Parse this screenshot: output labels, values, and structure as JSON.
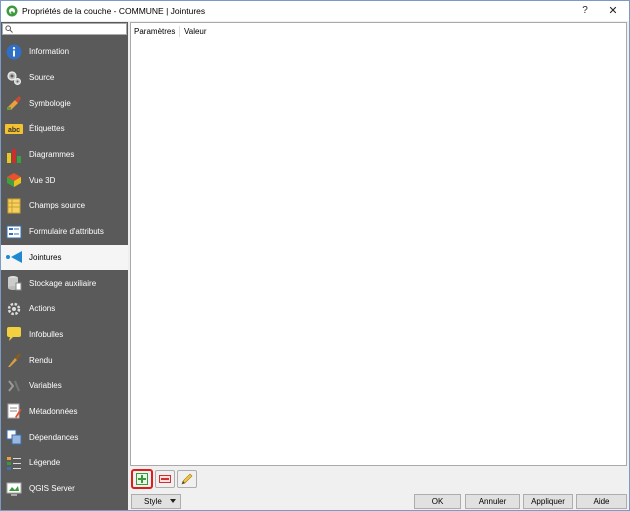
{
  "window": {
    "title": "Propriétés de la couche - COMMUNE | Jointures",
    "help_label": "?",
    "close_label": "✕"
  },
  "search": {
    "placeholder": ""
  },
  "sidebar": {
    "items": [
      {
        "label": "Information",
        "icon": "information-icon",
        "active": false
      },
      {
        "label": "Source",
        "icon": "source-icon",
        "active": false
      },
      {
        "label": "Symbologie",
        "icon": "symbology-icon",
        "active": false
      },
      {
        "label": "Étiquettes",
        "icon": "labels-icon",
        "active": false
      },
      {
        "label": "Diagrammes",
        "icon": "diagrams-icon",
        "active": false
      },
      {
        "label": "Vue 3D",
        "icon": "view-3d-icon",
        "active": false
      },
      {
        "label": "Champs source",
        "icon": "source-fields-icon",
        "active": false
      },
      {
        "label": "Formulaire d'attributs",
        "icon": "attributes-form-icon",
        "active": false
      },
      {
        "label": "Jointures",
        "icon": "joins-icon",
        "active": true
      },
      {
        "label": "Stockage auxiliaire",
        "icon": "auxiliary-storage-icon",
        "active": false
      },
      {
        "label": "Actions",
        "icon": "actions-icon",
        "active": false
      },
      {
        "label": "Infobulles",
        "icon": "tooltips-icon",
        "active": false
      },
      {
        "label": "Rendu",
        "icon": "rendering-icon",
        "active": false
      },
      {
        "label": "Variables",
        "icon": "variables-icon",
        "active": false
      },
      {
        "label": "Métadonnées",
        "icon": "metadata-icon",
        "active": false
      },
      {
        "label": "Dépendances",
        "icon": "dependencies-icon",
        "active": false
      },
      {
        "label": "Légende",
        "icon": "legend-icon",
        "active": false
      },
      {
        "label": "QGIS Server",
        "icon": "qgis-server-icon",
        "active": false
      }
    ]
  },
  "joins_table": {
    "columns": [
      "Paramètres",
      "Valeur"
    ]
  },
  "toolbar": {
    "add_icon": "add-join-icon",
    "remove_icon": "remove-join-icon",
    "edit_icon": "edit-join-icon",
    "highlight_color": "#e01b1b"
  },
  "footer": {
    "style_label": "Style",
    "ok_label": "OK",
    "cancel_label": "Annuler",
    "apply_label": "Appliquer",
    "help_label": "Aide"
  },
  "colors": {
    "sidebar_bg": "#5a5a5a",
    "accent_blue": "#1e88d2"
  }
}
